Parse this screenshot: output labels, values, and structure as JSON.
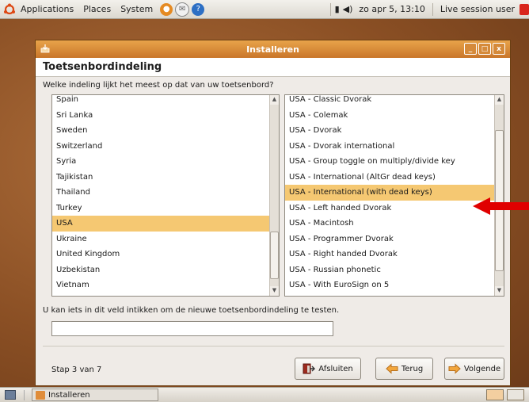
{
  "top_panel": {
    "menus": [
      "Applications",
      "Places",
      "System"
    ],
    "datetime": "zo apr 5, 13:10",
    "user": "Live session user"
  },
  "window": {
    "title": "Installeren",
    "buttons": {
      "minimize": "_",
      "maximize": "□",
      "close": "x"
    }
  },
  "page": {
    "title": "Toetsenbordindeling",
    "question": "Welke indeling lijkt het meest op dat van uw toetsenbord?",
    "hint": "U kan iets in dit veld intikken om de nieuwe toetsenbordindeling te testen.",
    "test_field_value": "",
    "step": "Stap 3 van 7"
  },
  "countries": {
    "items": [
      "Spain",
      "Sri Lanka",
      "Sweden",
      "Switzerland",
      "Syria",
      "Tajikistan",
      "Thailand",
      "Turkey",
      "USA",
      "Ukraine",
      "United Kingdom",
      "Uzbekistan",
      "Vietnam"
    ],
    "selected": "USA"
  },
  "layouts": {
    "items": [
      "USA - Classic Dvorak",
      "USA - Colemak",
      "USA - Dvorak",
      "USA - Dvorak international",
      "USA - Group toggle on multiply/divide key",
      "USA - International (AltGr dead keys)",
      "USA - International (with dead keys)",
      "USA - Left handed Dvorak",
      "USA - Macintosh",
      "USA - Programmer Dvorak",
      "USA - Right handed Dvorak",
      "USA - Russian phonetic",
      "USA - With EuroSign on 5"
    ],
    "selected": "USA - International (with dead keys)"
  },
  "buttons": {
    "quit": "Afsluiten",
    "back": "Terug",
    "next": "Volgende"
  },
  "taskbar": {
    "window_label": "Installeren"
  },
  "colors": {
    "accent": "#e0913f",
    "selection": "#f5c872",
    "arrow": "#e00000"
  }
}
